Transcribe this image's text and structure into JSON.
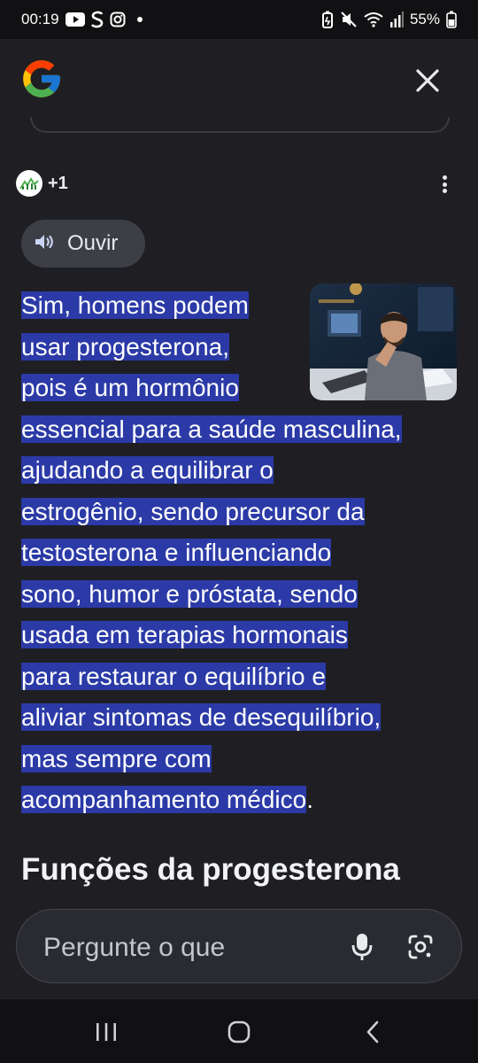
{
  "status_bar": {
    "time": "00:19",
    "battery": "55%",
    "icons": [
      "youtube-icon",
      "s-app-icon",
      "instagram-icon",
      "notification-dot",
      "battery-saver-icon",
      "mute-icon",
      "wifi-icon",
      "signal-icon",
      "battery-icon"
    ]
  },
  "header": {
    "logo": "google-logo",
    "close_icon": "close-icon"
  },
  "sources": {
    "count_label": "+1"
  },
  "listen": {
    "label": "Ouvir"
  },
  "answer": {
    "lines_short": [
      "Sim, homens podem",
      "usar progesterona,",
      "pois é um hormônio"
    ],
    "lines": [
      "essencial para a saúde masculina,",
      "ajudando a equilibrar o",
      "estrogênio, sendo precursor da",
      "testosterona e influenciando",
      "sono, humor e próstata, sendo",
      "usada em terapias hormonais",
      "para restaurar o equilíbrio e",
      "aliviar sintomas de desequilíbrio,",
      "mas sempre com"
    ],
    "last_line": "acompanhamento médico",
    "last_punct": "."
  },
  "section": {
    "title": "Funções da progesterona"
  },
  "ask": {
    "placeholder": "Pergunte o que"
  },
  "colors": {
    "background": "#1f1f23",
    "highlight": "#2b3aa6",
    "chip": "#3c3f45"
  }
}
